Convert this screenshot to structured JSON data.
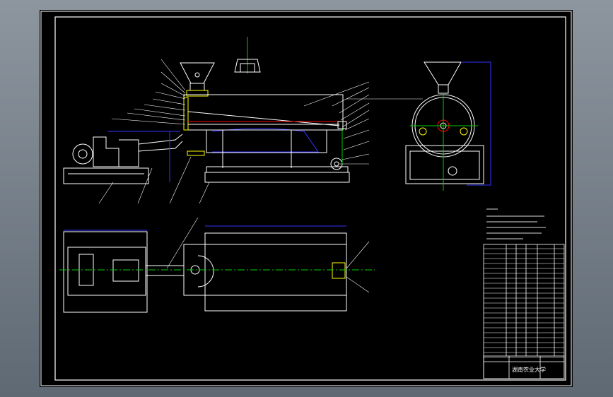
{
  "drawing": {
    "background": "#000000",
    "viewport_gradient_top": "#8d969f",
    "viewport_gradient_bottom": "#5f6973",
    "frame_color": "#ffffff",
    "centerline_color": "#00cc00",
    "dimension_color": "#3333ff",
    "accent_color": "#ffff00",
    "marker_color": "#ff0000",
    "text_color": "#ffffff"
  },
  "title_block": {
    "school_title": "湖南农业大学"
  }
}
